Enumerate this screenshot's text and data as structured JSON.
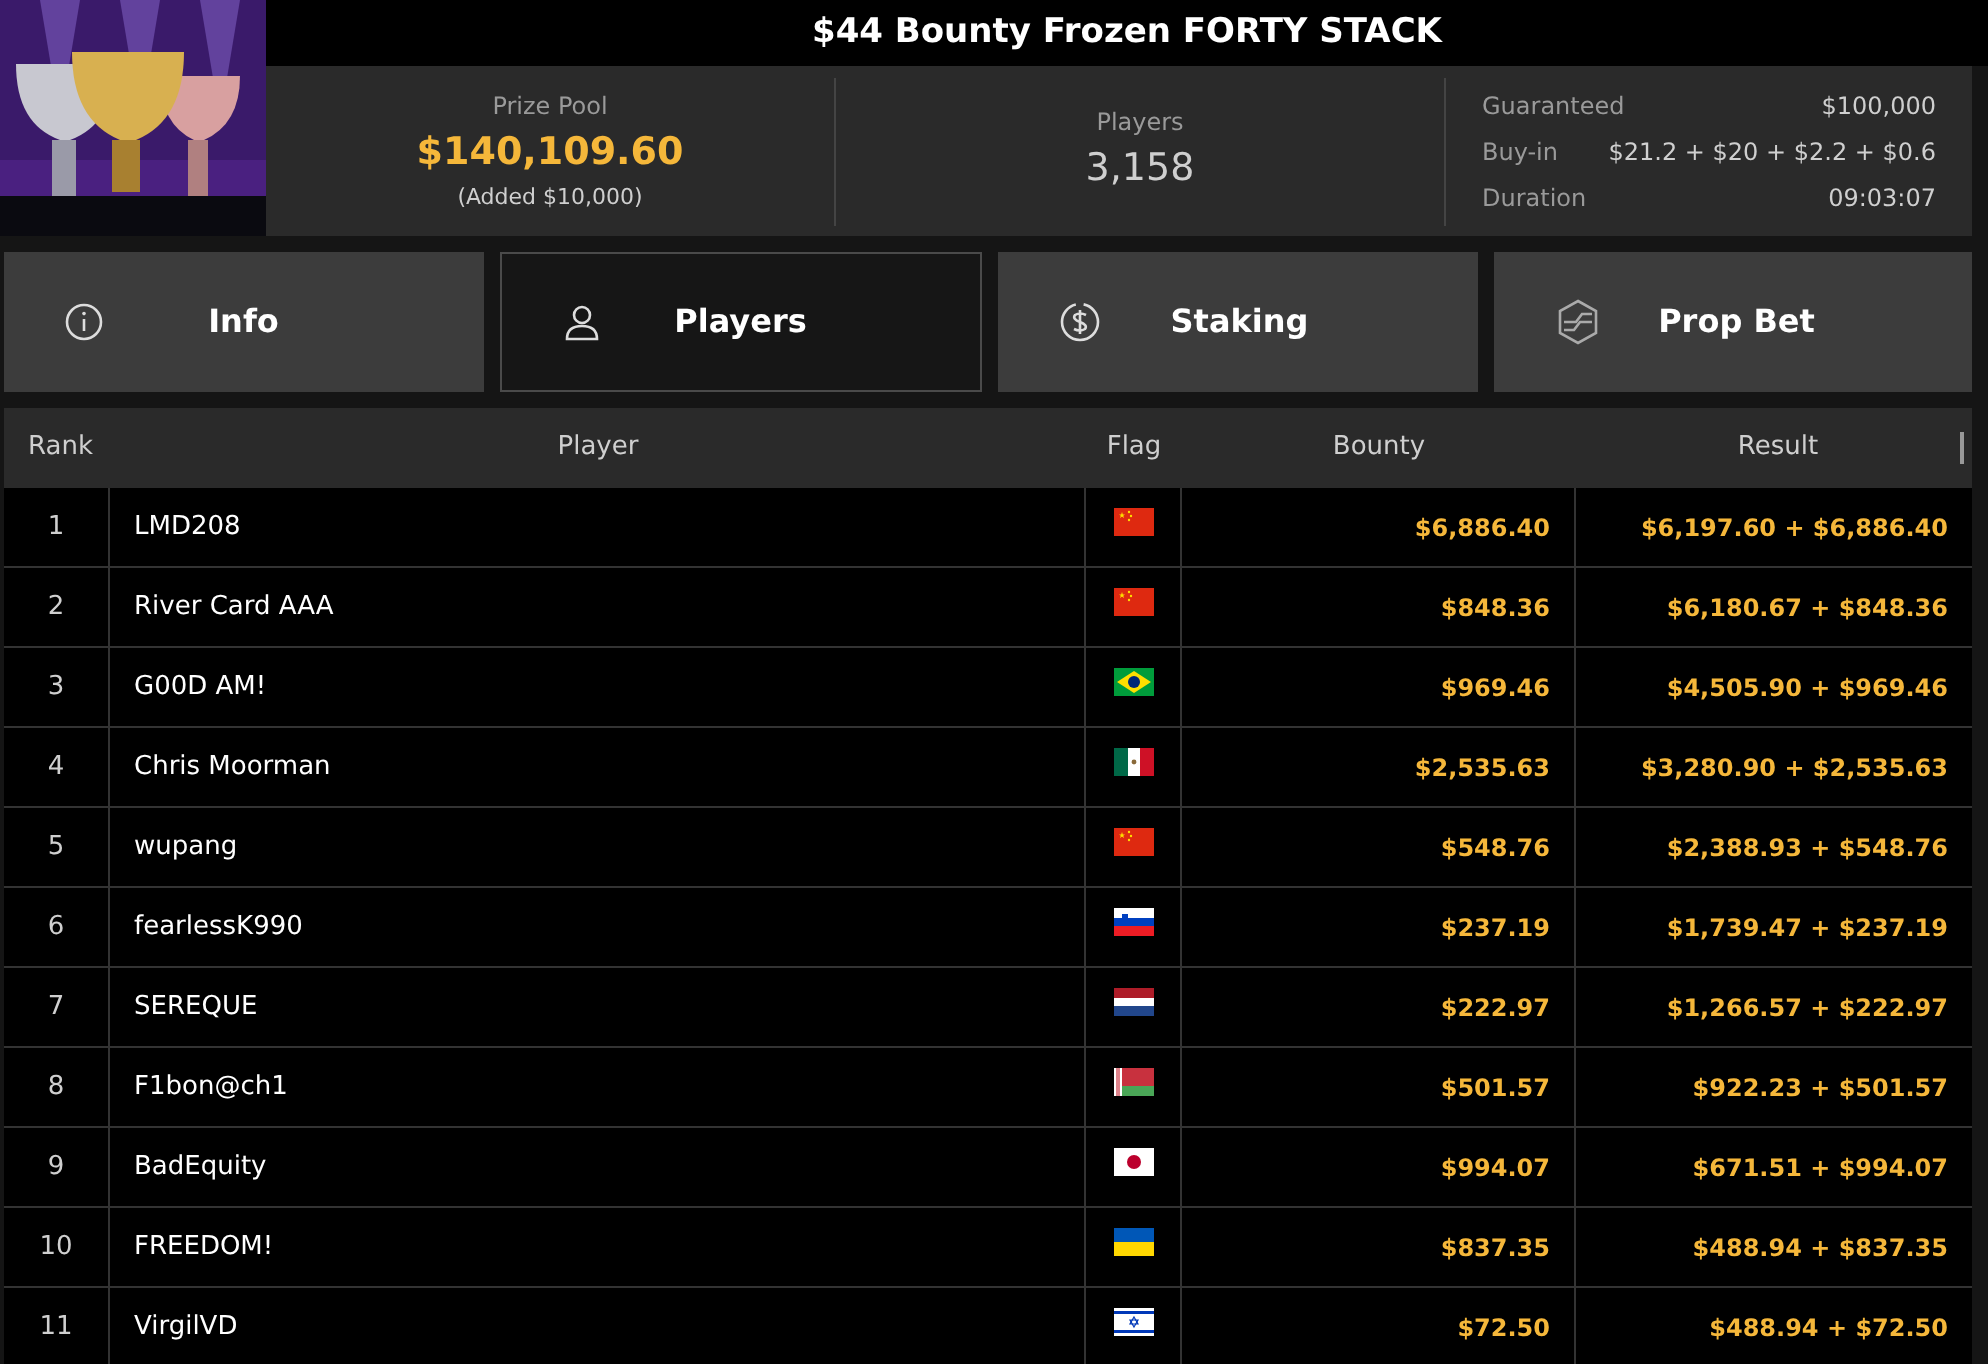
{
  "title": "$44 Bounty Frozen FORTY STACK",
  "header": {
    "kind": "picture",
    "prize_pool": {
      "label": "Prize Pool",
      "value": "$140,109.60",
      "note": "(Added $10,000)"
    },
    "players": {
      "label": "Players",
      "value": "3,158"
    },
    "details": [
      {
        "label": "Guaranteed",
        "value": "$100,000"
      },
      {
        "label": "Buy-in",
        "value": "$21.2 + $20 + $2.2 + $0.6"
      },
      {
        "label": "Duration",
        "value": "09:03:07"
      }
    ]
  },
  "tabs": [
    {
      "label": "Info",
      "selected": false
    },
    {
      "label": "Players",
      "selected": true
    },
    {
      "label": "Staking",
      "selected": false
    },
    {
      "label": "Prop Bet",
      "selected": false
    }
  ],
  "table": {
    "columns": [
      "Rank",
      "Player",
      "Flag",
      "Bounty",
      "Result"
    ],
    "rows": [
      {
        "rank": "1",
        "player": "LMD208",
        "kind": "cn",
        "bounty": "$6,886.40",
        "result": "$6,197.60 + $6,886.40"
      },
      {
        "rank": "2",
        "player": "River Card AAA",
        "kind": "cn",
        "bounty": "$848.36",
        "result": "$6,180.67 + $848.36"
      },
      {
        "rank": "3",
        "player": "G00D AM!",
        "kind": "br",
        "bounty": "$969.46",
        "result": "$4,505.90 + $969.46"
      },
      {
        "rank": "4",
        "player": "Chris Moorman",
        "kind": "mx",
        "bounty": "$2,535.63",
        "result": "$3,280.90 + $2,535.63"
      },
      {
        "rank": "5",
        "player": "wupang",
        "kind": "cn",
        "bounty": "$548.76",
        "result": "$2,388.93 + $548.76"
      },
      {
        "rank": "6",
        "player": "fearlessK990",
        "kind": "si",
        "bounty": "$237.19",
        "result": "$1,739.47 + $237.19"
      },
      {
        "rank": "7",
        "player": "SEREQUE",
        "kind": "nl",
        "bounty": "$222.97",
        "result": "$1,266.57 + $222.97"
      },
      {
        "rank": "8",
        "player": "F1bon@ch1",
        "kind": "by",
        "bounty": "$501.57",
        "result": "$922.23 + $501.57"
      },
      {
        "rank": "9",
        "player": "BadEquity",
        "kind": "jp",
        "bounty": "$994.07",
        "result": "$671.51 + $994.07"
      },
      {
        "rank": "10",
        "player": "FREEDOM!",
        "kind": "ua",
        "bounty": "$837.35",
        "result": "$488.94 + $837.35"
      },
      {
        "rank": "11",
        "player": "VirgilVD",
        "kind": "il",
        "bounty": "$72.50",
        "result": "$488.94 + $72.50"
      }
    ]
  }
}
